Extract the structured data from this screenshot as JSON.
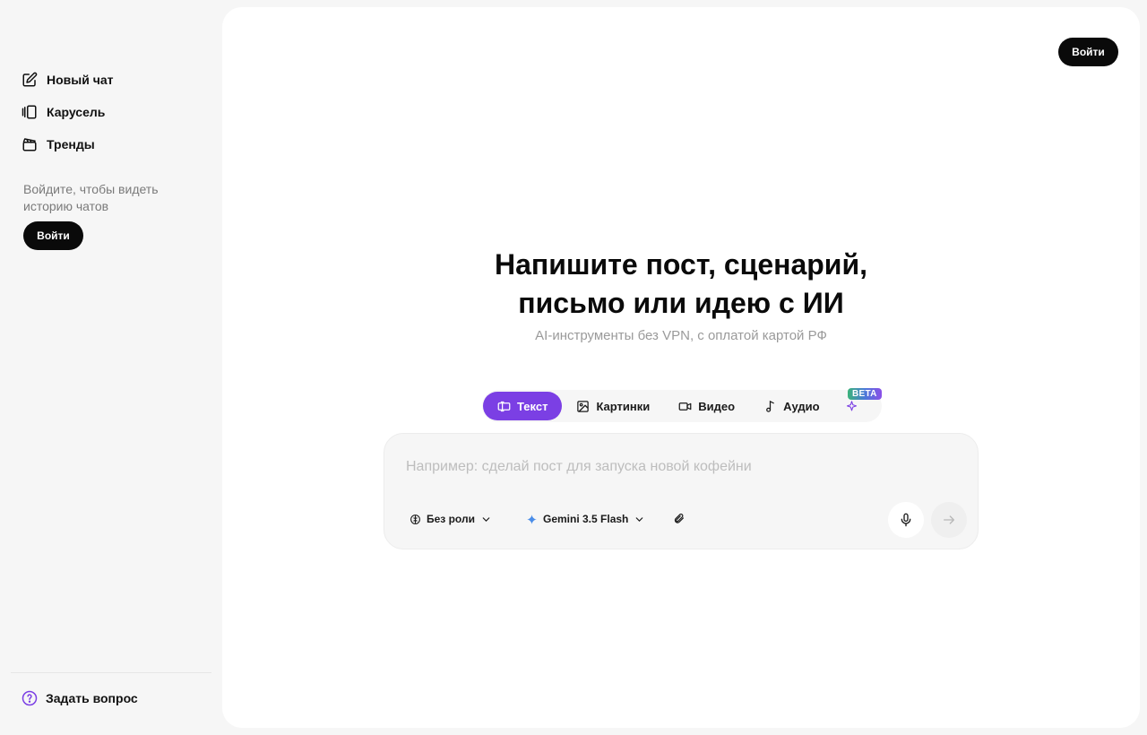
{
  "sidebar": {
    "items": [
      {
        "label": "Новый чат",
        "icon": "edit-icon"
      },
      {
        "label": "Карусель",
        "icon": "carousel-icon"
      },
      {
        "label": "Тренды",
        "icon": "clapperboard-icon"
      }
    ],
    "login_hint": "Войдите, чтобы видеть историю чатов",
    "login_label": "Войти",
    "help_label": "Задать вопрос"
  },
  "header": {
    "login_label": "Войти"
  },
  "hero": {
    "title_line1": "Напишите пост, сценарий,",
    "title_line2": "письмо или идею с ИИ",
    "subtitle": "AI-инструменты без VPN, с оплатой картой РФ"
  },
  "tabs": [
    {
      "label": "Текст",
      "active": true
    },
    {
      "label": "Картинки",
      "active": false
    },
    {
      "label": "Видео",
      "active": false
    },
    {
      "label": "Аудио",
      "active": false
    }
  ],
  "beta_badge": "BETA",
  "composer": {
    "placeholder": "Например: сделай пост для запуска новой кофейни",
    "role_label": "Без роли",
    "model_label": "Gemini 3.5 Flash"
  },
  "colors": {
    "accent": "#7b3fe4",
    "dark": "#0a0a0a",
    "background": "#f6f6f6"
  }
}
